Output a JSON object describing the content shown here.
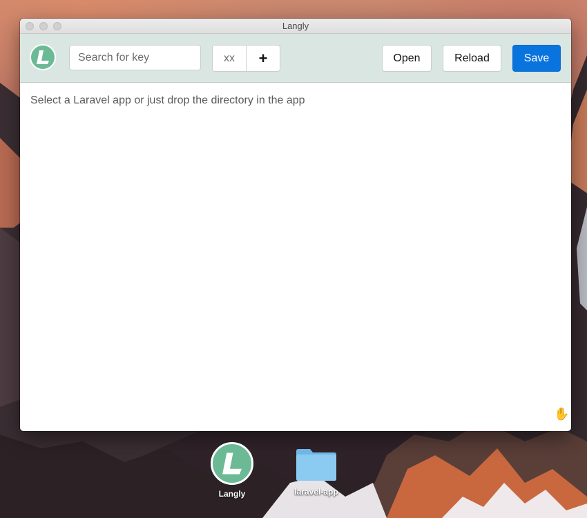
{
  "window": {
    "title": "Langly"
  },
  "toolbar": {
    "search_placeholder": "Search for key",
    "lang_placeholder": "xx",
    "add_label": "+",
    "open_label": "Open",
    "reload_label": "Reload",
    "save_label": "Save"
  },
  "content": {
    "hint": "Select a Laravel app or just drop the directory in the app"
  },
  "desktop": {
    "icons": [
      {
        "label": "Langly",
        "icon": "langly-app-icon"
      },
      {
        "label": "laravel-app",
        "icon": "folder-icon"
      }
    ]
  },
  "colors": {
    "accent": "#0a74de",
    "toolbar_bg": "#d9e6e1",
    "logo_green": "#6cb995",
    "folder_blue": "#86c7ee"
  }
}
